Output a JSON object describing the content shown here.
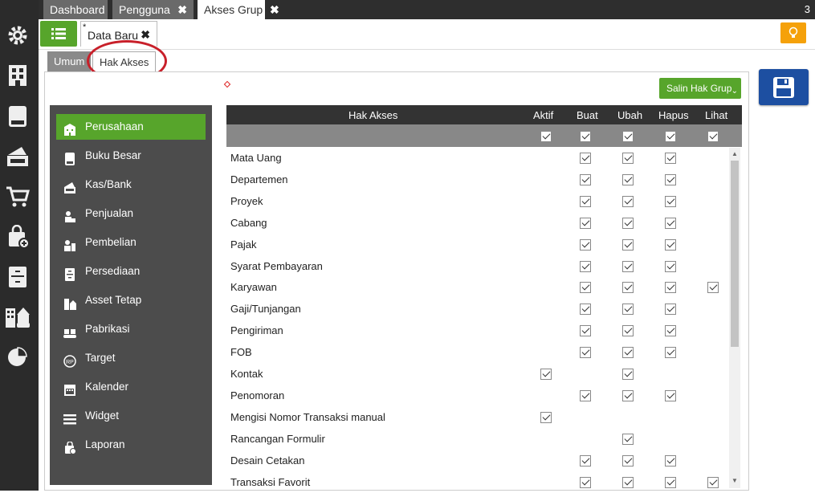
{
  "top_tabs": [
    {
      "label": "Dashboard",
      "closable": false
    },
    {
      "label": "Pengguna",
      "closable": true
    },
    {
      "label": "Akses Grup",
      "closable": true,
      "active": true
    }
  ],
  "tab_counter": "3",
  "doc_tab": {
    "modified_marker": "*",
    "label": "Data Baru"
  },
  "sub_tabs": {
    "umum": "Umum",
    "hak_akses": "Hak Akses"
  },
  "salin_button": {
    "label": "Salin Hak Grup",
    "chevron": "⌄"
  },
  "menu": [
    {
      "label": "Perusahaan",
      "icon": "building-icon",
      "active": true
    },
    {
      "label": "Buku Besar",
      "icon": "ledger-icon"
    },
    {
      "label": "Kas/Bank",
      "icon": "cash-bank-icon"
    },
    {
      "label": "Penjualan",
      "icon": "sales-icon"
    },
    {
      "label": "Pembelian",
      "icon": "purchase-icon"
    },
    {
      "label": "Persediaan",
      "icon": "inventory-icon"
    },
    {
      "label": "Asset Tetap",
      "icon": "fixed-asset-icon"
    },
    {
      "label": "Pabrikasi",
      "icon": "manufacturing-icon"
    },
    {
      "label": "Target",
      "icon": "target-icon"
    },
    {
      "label": "Kalender",
      "icon": "calendar-icon"
    },
    {
      "label": "Widget",
      "icon": "widget-icon"
    },
    {
      "label": "Laporan",
      "icon": "report-icon"
    }
  ],
  "grid": {
    "columns": {
      "name": "Hak Akses",
      "aktif": "Aktif",
      "buat": "Buat",
      "ubah": "Ubah",
      "hapus": "Hapus",
      "lihat": "Lihat"
    },
    "header_checks": {
      "aktif": true,
      "buat": true,
      "ubah": true,
      "hapus": true,
      "lihat": true
    },
    "rows": [
      {
        "name": "Mata Uang",
        "aktif": null,
        "buat": true,
        "ubah": true,
        "hapus": true,
        "lihat": null
      },
      {
        "name": "Departemen",
        "aktif": null,
        "buat": true,
        "ubah": true,
        "hapus": true,
        "lihat": null
      },
      {
        "name": "Proyek",
        "aktif": null,
        "buat": true,
        "ubah": true,
        "hapus": true,
        "lihat": null
      },
      {
        "name": "Cabang",
        "aktif": null,
        "buat": true,
        "ubah": true,
        "hapus": true,
        "lihat": null
      },
      {
        "name": "Pajak",
        "aktif": null,
        "buat": true,
        "ubah": true,
        "hapus": true,
        "lihat": null
      },
      {
        "name": "Syarat Pembayaran",
        "aktif": null,
        "buat": true,
        "ubah": true,
        "hapus": true,
        "lihat": null
      },
      {
        "name": "Karyawan",
        "aktif": null,
        "buat": true,
        "ubah": true,
        "hapus": true,
        "lihat": true
      },
      {
        "name": "Gaji/Tunjangan",
        "aktif": null,
        "buat": true,
        "ubah": true,
        "hapus": true,
        "lihat": null
      },
      {
        "name": "Pengiriman",
        "aktif": null,
        "buat": true,
        "ubah": true,
        "hapus": true,
        "lihat": null
      },
      {
        "name": "FOB",
        "aktif": null,
        "buat": true,
        "ubah": true,
        "hapus": true,
        "lihat": null
      },
      {
        "name": "Kontak",
        "aktif": true,
        "buat": null,
        "ubah": true,
        "hapus": null,
        "lihat": null
      },
      {
        "name": "Penomoran",
        "aktif": null,
        "buat": true,
        "ubah": true,
        "hapus": true,
        "lihat": null
      },
      {
        "name": "Mengisi Nomor Transaksi manual",
        "aktif": true,
        "buat": null,
        "ubah": null,
        "hapus": null,
        "lihat": null
      },
      {
        "name": "Rancangan Formulir",
        "aktif": null,
        "buat": null,
        "ubah": true,
        "hapus": null,
        "lihat": null
      },
      {
        "name": "Desain Cetakan",
        "aktif": null,
        "buat": true,
        "ubah": true,
        "hapus": true,
        "lihat": null
      },
      {
        "name": "Transaksi Favorit",
        "aktif": null,
        "buat": true,
        "ubah": true,
        "hapus": true,
        "lihat": true
      }
    ]
  },
  "left_nav_icons": [
    "settings-icon",
    "company-icon",
    "ledger-icon",
    "cash-icon",
    "cart-icon",
    "purchase-bag-icon",
    "inventory-icon",
    "asset-icon",
    "chart-pie-icon"
  ],
  "colors": {
    "accent_green": "#57a52b",
    "save_blue": "#1d4fa1",
    "dark_bar": "#2b2b2b",
    "highlight_circle": "#c8202a"
  }
}
